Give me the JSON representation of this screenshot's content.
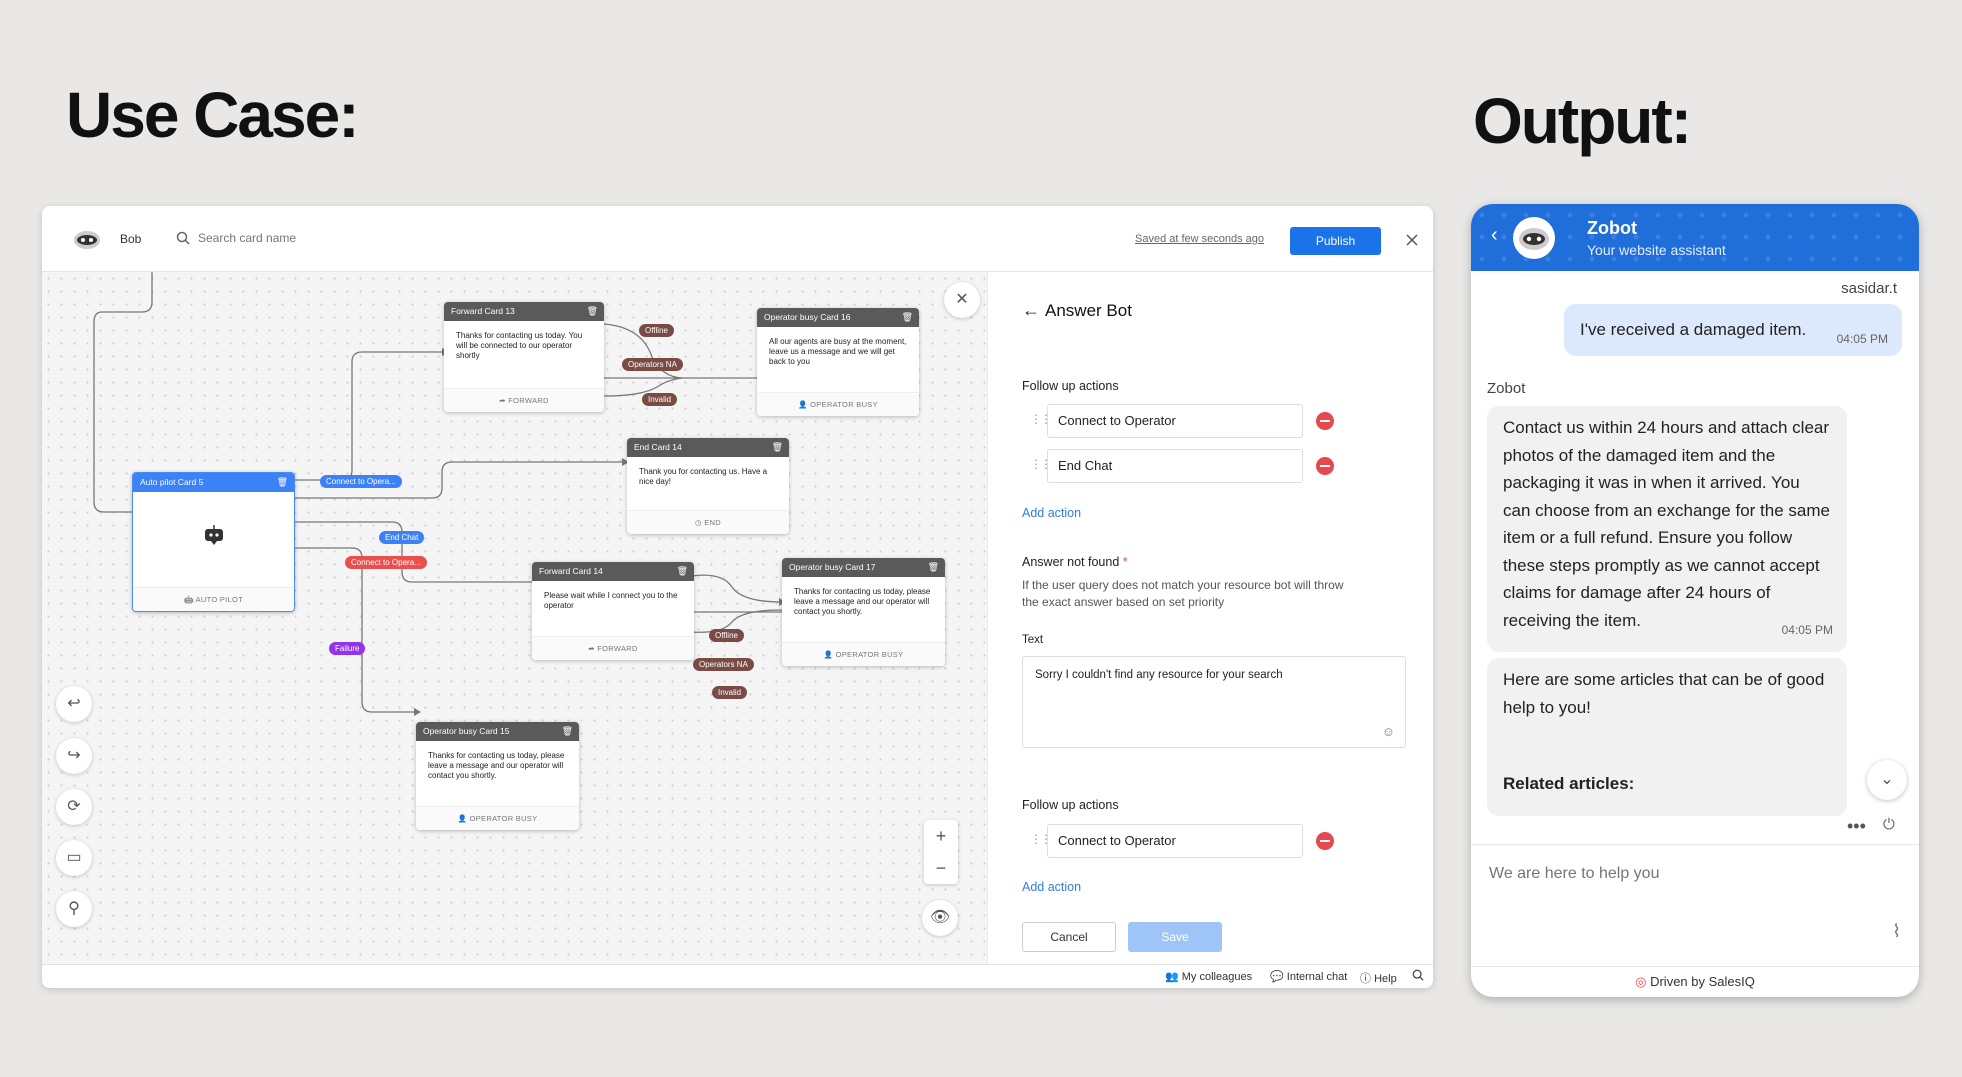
{
  "headings": {
    "use_case": "Use Case:",
    "output": "Output:"
  },
  "editor": {
    "bot_name": "Bob",
    "search_placeholder": "Search card name",
    "saved_status": "Saved at few seconds ago",
    "publish_label": "Publish",
    "cards": {
      "forward13": {
        "title": "Forward Card 13",
        "body": "Thanks for contacting us today. You will be connected to our operator shortly",
        "footer": "FORWARD"
      },
      "busy16": {
        "title": "Operator busy Card 16",
        "body": "All our agents are busy at the moment, leave us a message and we will get back to you",
        "footer": "OPERATOR BUSY"
      },
      "end14": {
        "title": "End Card 14",
        "body": "Thank you for contacting us. Have a nice day!",
        "footer": "END"
      },
      "autopilot5": {
        "title": "Auto pilot Card 5",
        "footer": "AUTO PILOT"
      },
      "forward14": {
        "title": "Forward Card 14",
        "body": "Please wait while I connect you to the operator",
        "footer": "FORWARD"
      },
      "busy17": {
        "title": "Operator busy Card 17",
        "body": "Thanks for contacting us today, please leave a message and our operator will contact you shortly.",
        "footer": "OPERATOR BUSY"
      },
      "busy15": {
        "title": "Operator busy Card 15",
        "body": "Thanks for contacting us today, please leave a message and our operator will contact you shortly.",
        "footer": "OPERATOR BUSY"
      }
    },
    "tags": {
      "offline1": "Offline",
      "ops_na1": "Operators NA",
      "invalid1": "Invalid",
      "connect_blue": "Connect to Opera...",
      "end_chat": "End Chat",
      "connect_red": "Connect to Opera...",
      "failure": "Failure",
      "offline2": "Offline",
      "ops_na2": "Operators NA",
      "invalid2": "Invalid"
    },
    "panel": {
      "title": "Answer Bot",
      "follow_up_label": "Follow up actions",
      "actions": [
        "Connect to Operator",
        "End Chat"
      ],
      "add_action": "Add action",
      "not_found_label": "Answer not found",
      "required_mark": "*",
      "not_found_desc": "If the user query does not match your resource bot will throw the exact answer based on set priority",
      "text_label": "Text",
      "text_value": "Sorry I couldn't find any resource for your search",
      "follow_up_label2": "Follow up actions",
      "actions2": [
        "Connect to Operator"
      ],
      "add_action2": "Add action",
      "cancel_label": "Cancel",
      "save_label": "Save"
    },
    "status_bar": {
      "colleagues": "My colleagues",
      "internal_chat": "Internal chat",
      "help": "Help"
    },
    "zoom_in": "+",
    "zoom_out": "−"
  },
  "chat": {
    "bot_name": "Zobot",
    "subtitle": "Your website assistant",
    "user_name": "sasidar.t",
    "user_message": "I've received a damaged item.",
    "user_time": "04:05 PM",
    "bot_label": "Zobot",
    "bot_message": "Contact us within 24 hours and attach clear photos of the damaged item and the packaging it was in when it arrived. You can choose from an exchange for the same item or a full refund. Ensure you follow these steps promptly as we cannot accept claims for damage after 24 hours of receiving the item.",
    "bot_time": "04:05 PM",
    "bot_message2": "Here are some articles that can be of good help to you!",
    "related_label": "Related articles:",
    "input_placeholder": "We are here to help you",
    "footer": "Driven by SalesIQ"
  },
  "colors": {
    "accent": "#1f6ed9",
    "publish": "#1a73e8",
    "minus": "#e5484d",
    "card_header": "#5a5a5a"
  }
}
